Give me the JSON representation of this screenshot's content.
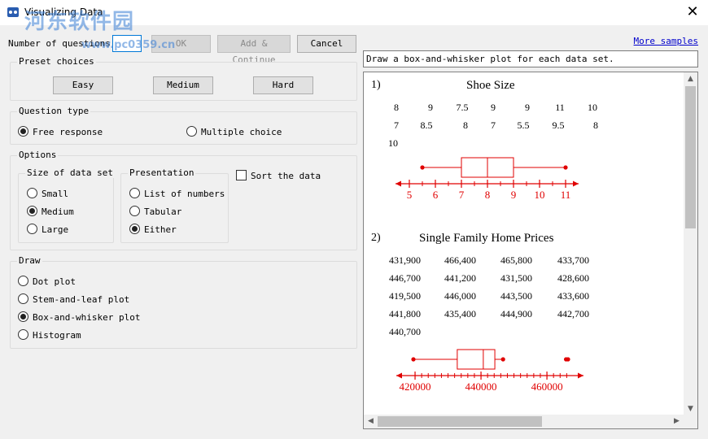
{
  "window": {
    "title": "Visualizing Data",
    "close_glyph": "✕"
  },
  "watermark": {
    "main": "河东软件园",
    "sub": "www.pc0359.cn"
  },
  "top": {
    "num_questions_label": "Number of questions:",
    "num_questions_value": "",
    "ok": "OK",
    "add_continue": "Add & Continue",
    "cancel": "Cancel"
  },
  "preset": {
    "title": "Preset choices",
    "easy": "Easy",
    "medium": "Medium",
    "hard": "Hard"
  },
  "question_type": {
    "title": "Question type",
    "free": "Free response",
    "multiple": "Multiple choice",
    "selected": "free"
  },
  "options": {
    "title": "Options",
    "size": {
      "title": "Size of data set",
      "items": [
        "Small",
        "Medium",
        "Large"
      ],
      "selected": "Medium"
    },
    "presentation": {
      "title": "Presentation",
      "items": [
        "List of numbers",
        "Tabular",
        "Either"
      ],
      "selected": "Either"
    },
    "sort_label": "Sort the data",
    "sort_checked": false
  },
  "draw": {
    "title": "Draw",
    "items": [
      "Dot plot",
      "Stem-and-leaf plot",
      "Box-and-whisker plot",
      "Histogram"
    ],
    "selected": "Box-and-whisker plot"
  },
  "more_samples": "More samples",
  "instruction": "Draw a box-and-whisker plot for each data set.",
  "problems": [
    {
      "number": "1)",
      "title": "Shoe Size",
      "rows": [
        [
          "8",
          "9",
          "7.5",
          "9",
          "9",
          "11",
          "10"
        ],
        [
          "7",
          "8.5",
          "8",
          "7",
          "5.5",
          "9.5",
          "8"
        ],
        [
          "10"
        ]
      ],
      "plot": {
        "min": 5.5,
        "q1": 7.0,
        "median": 8.0,
        "q3": 9.0,
        "max": 11.0,
        "axis_min": 5,
        "axis_max": 11,
        "ticks": [
          "5",
          "6",
          "7",
          "8",
          "9",
          "10",
          "11"
        ]
      }
    },
    {
      "number": "2)",
      "title": "Single Family Home Prices",
      "rows": [
        [
          "431,900",
          "466,400",
          "465,800",
          "433,700"
        ],
        [
          "446,700",
          "441,200",
          "431,500",
          "428,600"
        ],
        [
          "419,500",
          "446,000",
          "443,500",
          "433,600"
        ],
        [
          "441,800",
          "435,400",
          "444,900",
          "442,700"
        ],
        [
          "440,700"
        ]
      ],
      "plot": {
        "min": 419500,
        "q1": 432800,
        "median": 440700,
        "q3": 444200,
        "max": 446700,
        "outliers": [
          465800,
          466400
        ],
        "axis_min": 419500,
        "axis_max": 466400,
        "ticks": [
          "420000",
          "440000",
          "460000"
        ]
      }
    }
  ],
  "colors": {
    "plot": "#e00000",
    "link": "#0000cc"
  }
}
